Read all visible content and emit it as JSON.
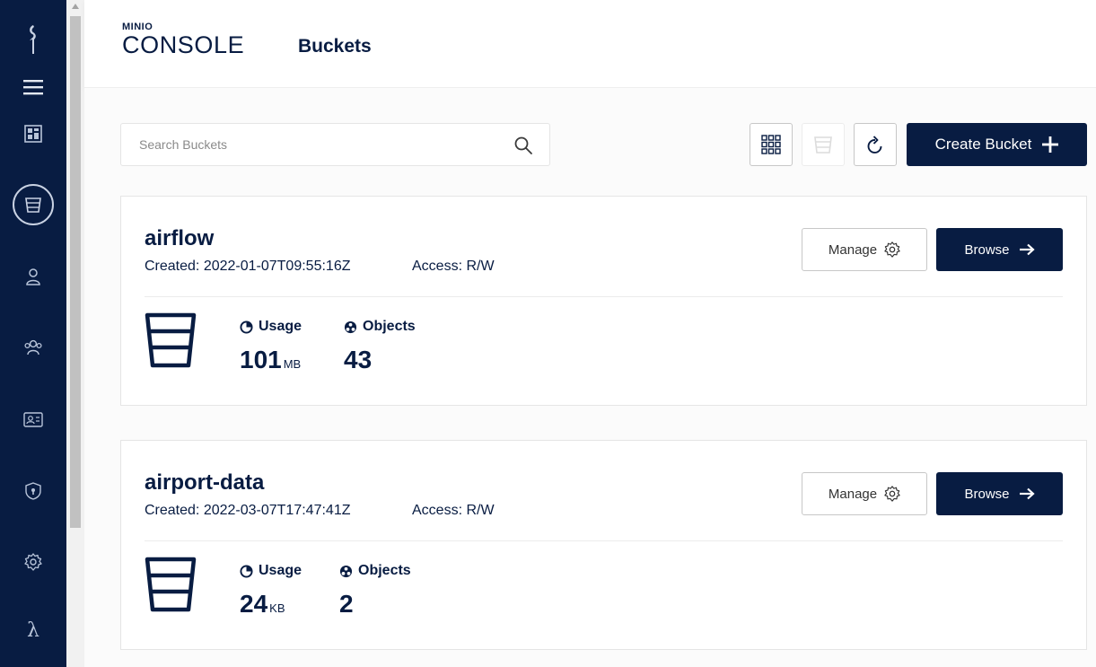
{
  "sidebar": {
    "items": [
      {
        "icon": "minio-bird-icon"
      },
      {
        "icon": "hamburger-menu-icon"
      },
      {
        "icon": "dashboard-icon"
      },
      {
        "icon": "bucket-icon",
        "active": true
      },
      {
        "icon": "user-icon"
      },
      {
        "icon": "groups-icon"
      },
      {
        "icon": "service-accounts-icon"
      },
      {
        "icon": "policies-shield-icon"
      },
      {
        "icon": "settings-gear-icon"
      },
      {
        "icon": "lambda-icon",
        "glyph": "λ"
      }
    ]
  },
  "header": {
    "logo_top": "MINIO",
    "logo_main": "CONSOLE",
    "title": "Buckets"
  },
  "toolbar": {
    "search_placeholder": "Search Buckets",
    "create_label": "Create Bucket"
  },
  "buckets": [
    {
      "name": "airflow",
      "created": "Created: 2022-01-07T09:55:16Z",
      "access": "Access: R/W",
      "manage_label": "Manage",
      "browse_label": "Browse",
      "usage_label": "Usage",
      "usage_value": "101",
      "usage_unit": "MB",
      "objects_label": "Objects",
      "objects_value": "43"
    },
    {
      "name": "airport-data",
      "created": "Created: 2022-03-07T17:47:41Z",
      "access": "Access: R/W",
      "manage_label": "Manage",
      "browse_label": "Browse",
      "usage_label": "Usage",
      "usage_value": "24",
      "usage_unit": "KB",
      "objects_label": "Objects",
      "objects_value": "2"
    }
  ],
  "colors": {
    "brand_navy": "#081c42",
    "sidebar_icon": "#b8c4d9"
  }
}
